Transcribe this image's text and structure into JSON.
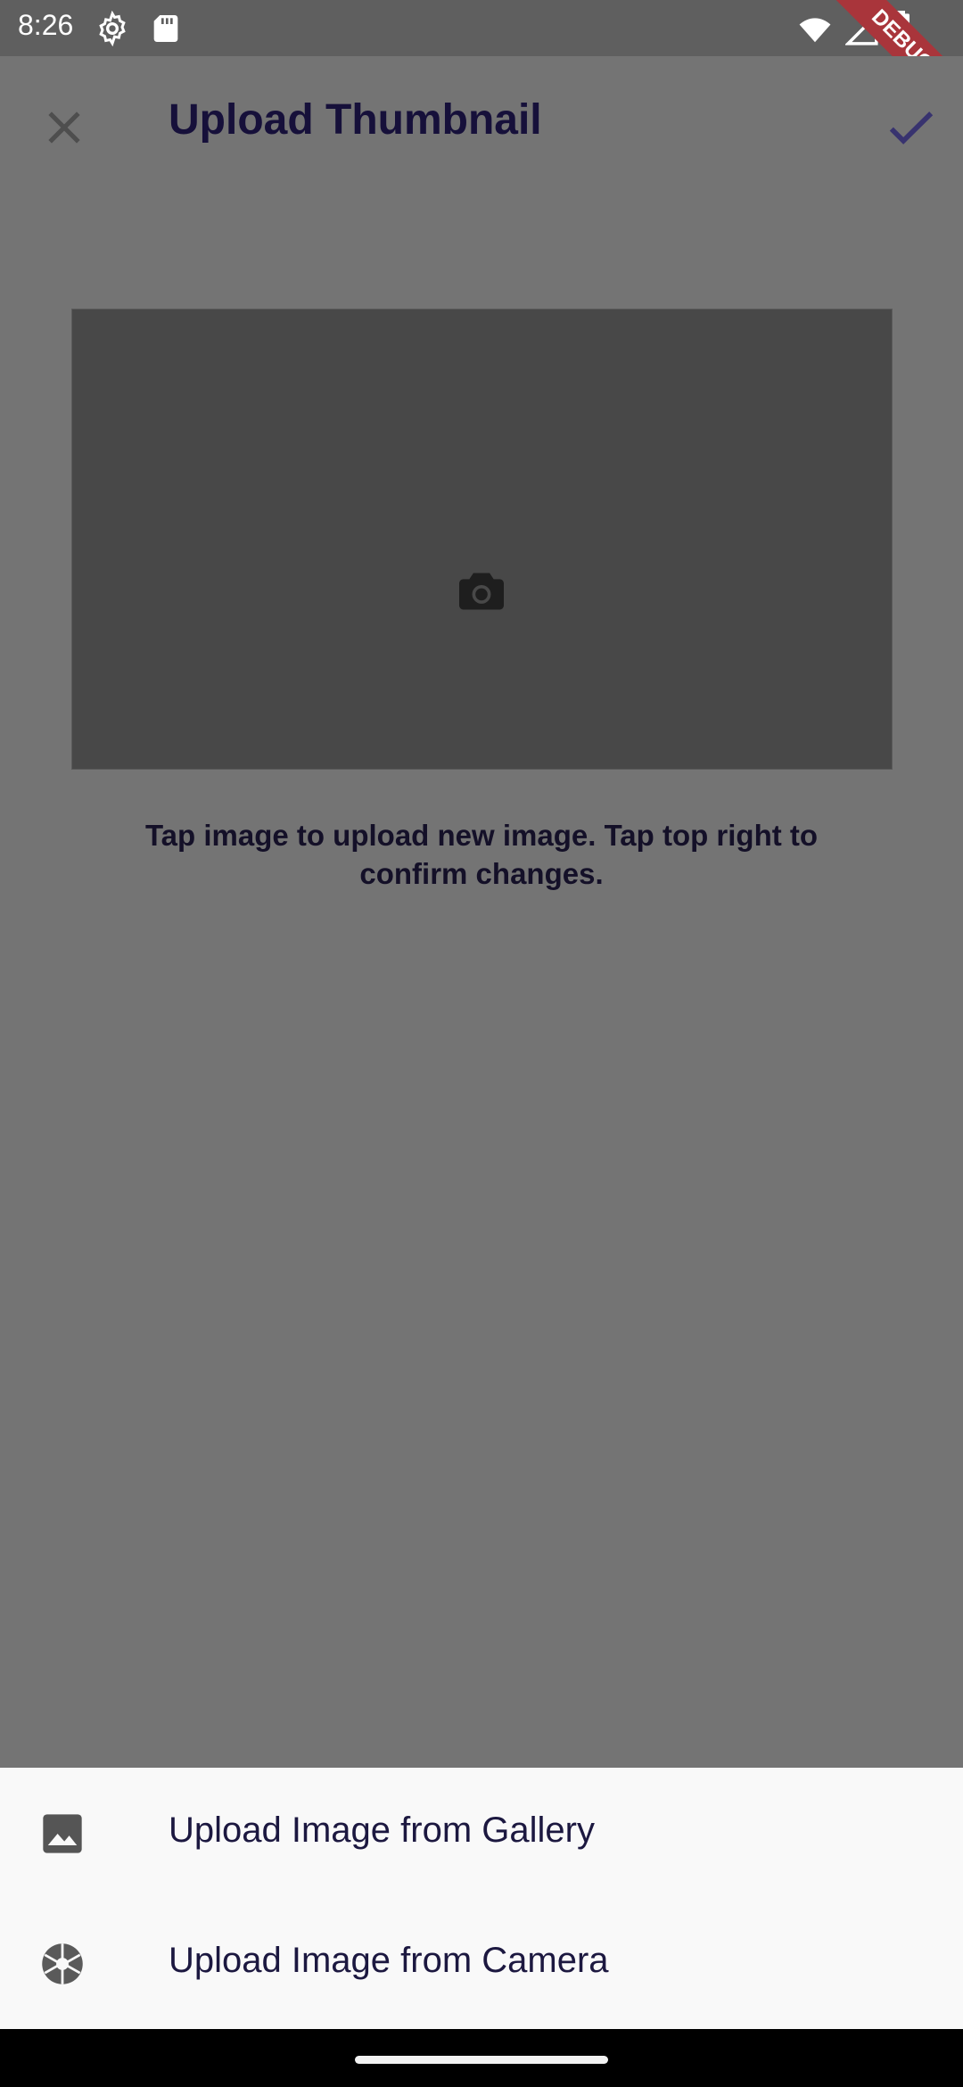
{
  "status_bar": {
    "time": "8:26",
    "debug_label": "DEBUG",
    "icons": [
      "settings-icon",
      "sd-card-icon",
      "wifi-icon",
      "signal-icon",
      "battery-icon"
    ]
  },
  "app_bar": {
    "title": "Upload Thumbnail",
    "close_icon": "close-icon",
    "confirm_icon": "check-icon",
    "accent_color": "#3f3a8c"
  },
  "thumbnail": {
    "icon": "camera-icon",
    "help_text": "Tap image to upload new image. Tap top right to confirm changes."
  },
  "bottom_sheet": {
    "items": [
      {
        "label": "Upload Image from Gallery",
        "icon": "gallery-icon"
      },
      {
        "label": "Upload Image from Camera",
        "icon": "camera-aperture-icon"
      }
    ]
  }
}
